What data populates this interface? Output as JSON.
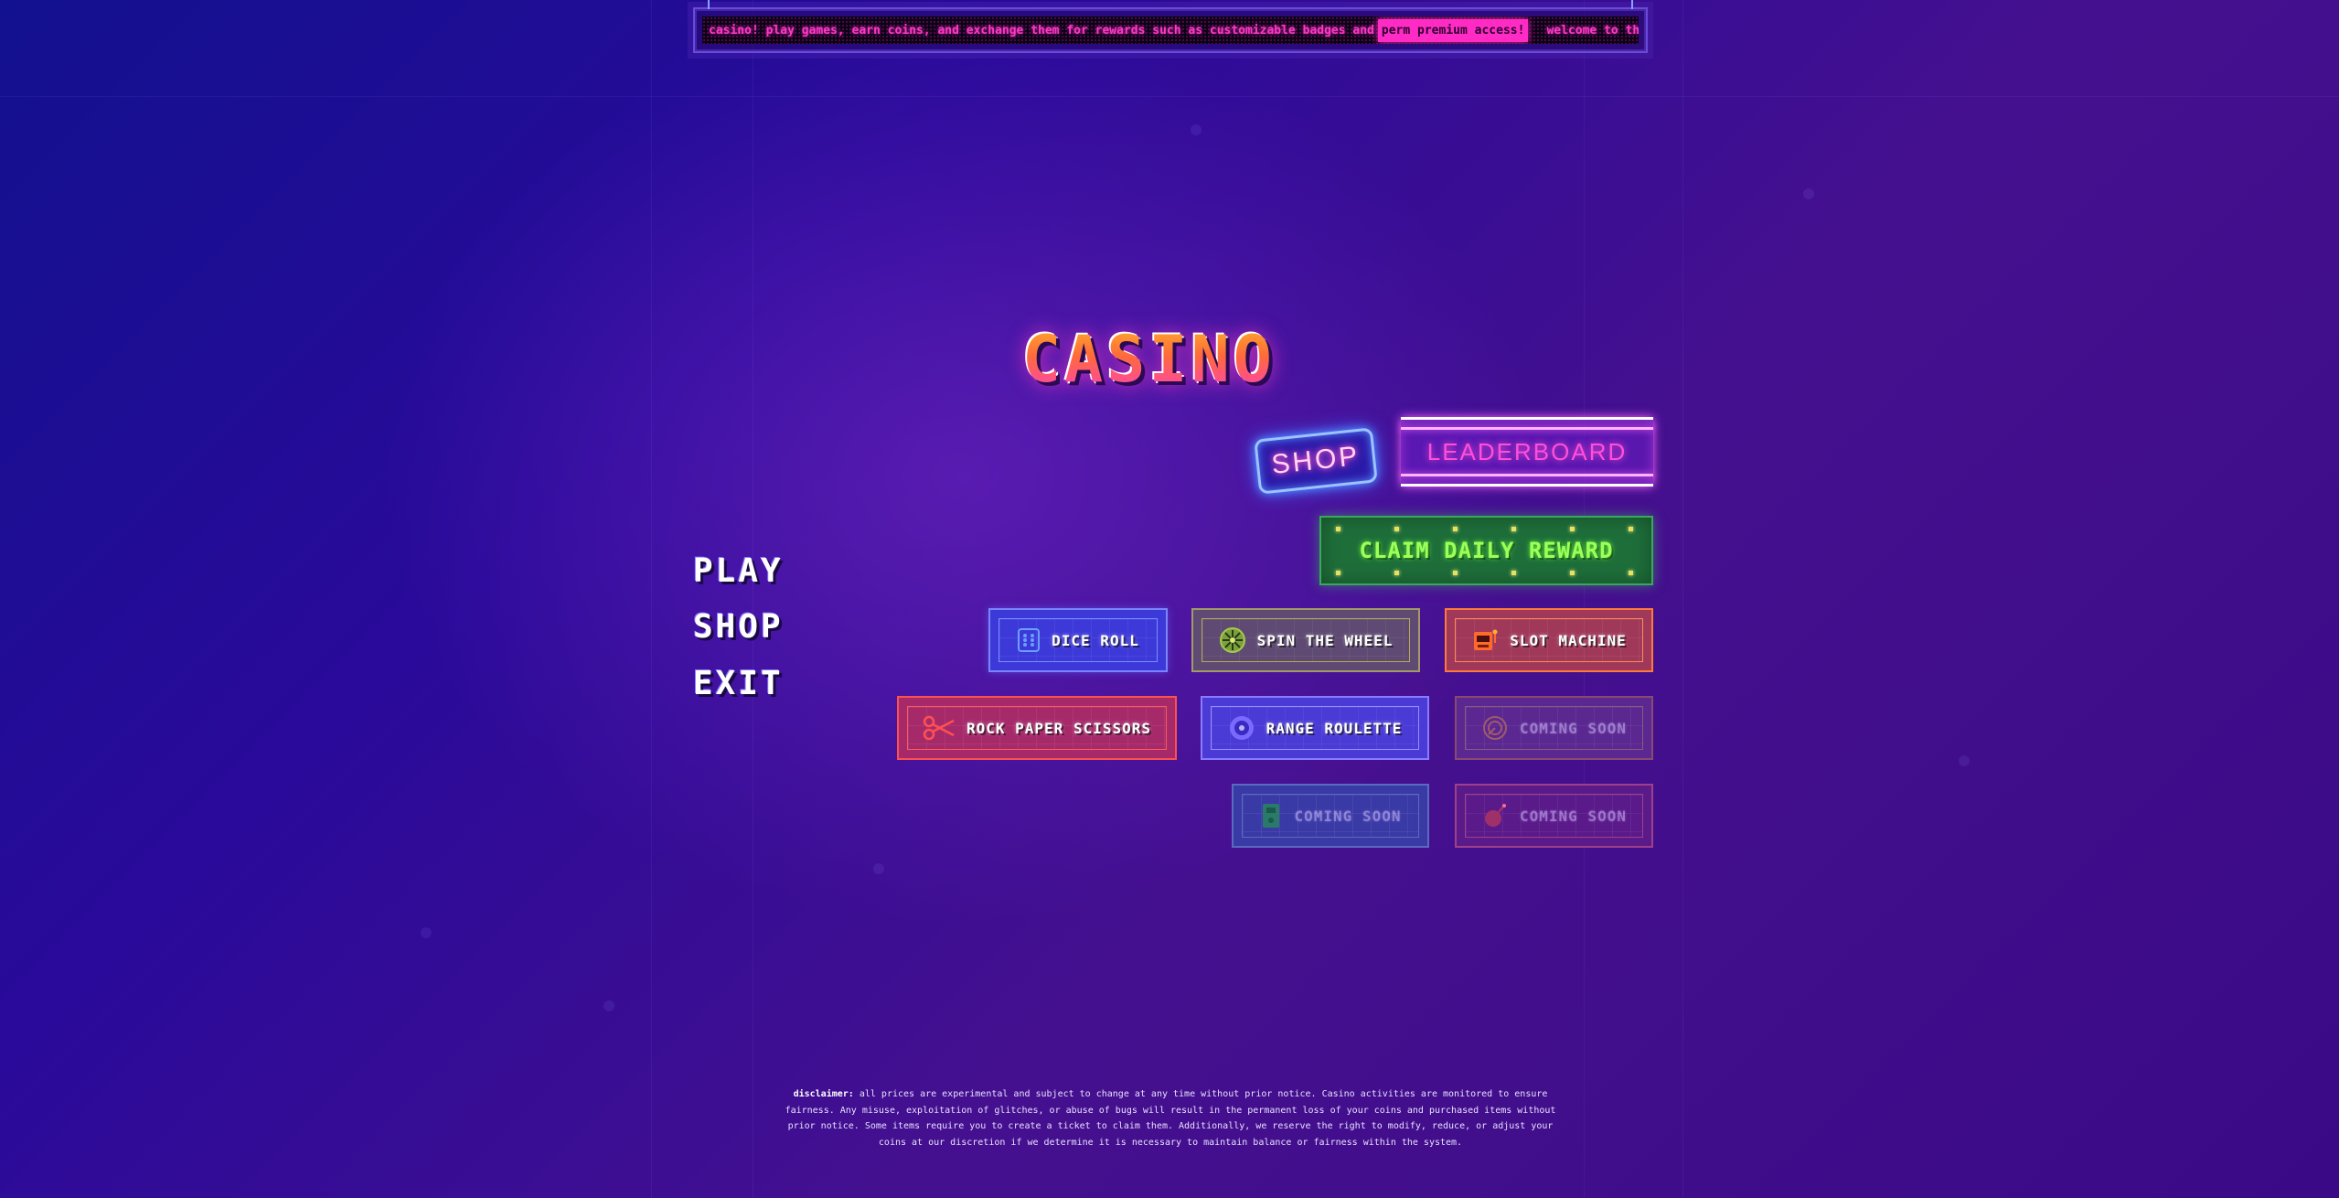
{
  "ticker": {
    "text_before": "casino! play games, earn coins, and exchange them for rewards such as customizable badges and",
    "highlight": "perm premium access!",
    "text_after": "welcome to the casino! play games"
  },
  "title": "CASINO",
  "menu": {
    "items": [
      "PLAY",
      "SHOP",
      "EXIT"
    ]
  },
  "header_buttons": {
    "shop_label": "SHOP",
    "leaderboard_label": "LEADERBOARD",
    "daily_reward_label": "CLAIM DAILY REWARD"
  },
  "games": {
    "dice": {
      "label": "DICE ROLL",
      "icon": "dice-icon"
    },
    "wheel": {
      "label": "SPIN THE WHEEL",
      "icon": "wheel-icon"
    },
    "slot": {
      "label": "SLOT MACHINE",
      "icon": "slot-machine-icon"
    },
    "rps": {
      "label": "ROCK PAPER SCISSORS",
      "icon": "scissors-icon"
    },
    "range": {
      "label": "RANGE ROULETTE",
      "icon": "roulette-icon"
    },
    "soon1": {
      "label": "COMING SOON",
      "icon": "dial-icon"
    },
    "soon2": {
      "label": "COMING SOON",
      "icon": "card-icon"
    },
    "soon3": {
      "label": "COMING SOON",
      "icon": "bomb-icon"
    }
  },
  "disclaimer": {
    "label": "disclaimer:",
    "text": "all prices are experimental and subject to change at any time without prior notice. Casino activities are monitored to ensure fairness. Any misuse, exploitation of glitches, or abuse of bugs will result in the permanent loss of your coins and purchased items without prior notice. Some items require you to create a ticket to claim them. Additionally, we reserve the right to modify, reduce, or adjust your coins at our discretion if we determine it is necessary to maintain balance or fairness within the system."
  },
  "colors": {
    "accent_pink": "#ff37c8",
    "title_orange": "#ff7a2e",
    "reward_green": "#9dff5a",
    "background": "#2a0a9a"
  }
}
